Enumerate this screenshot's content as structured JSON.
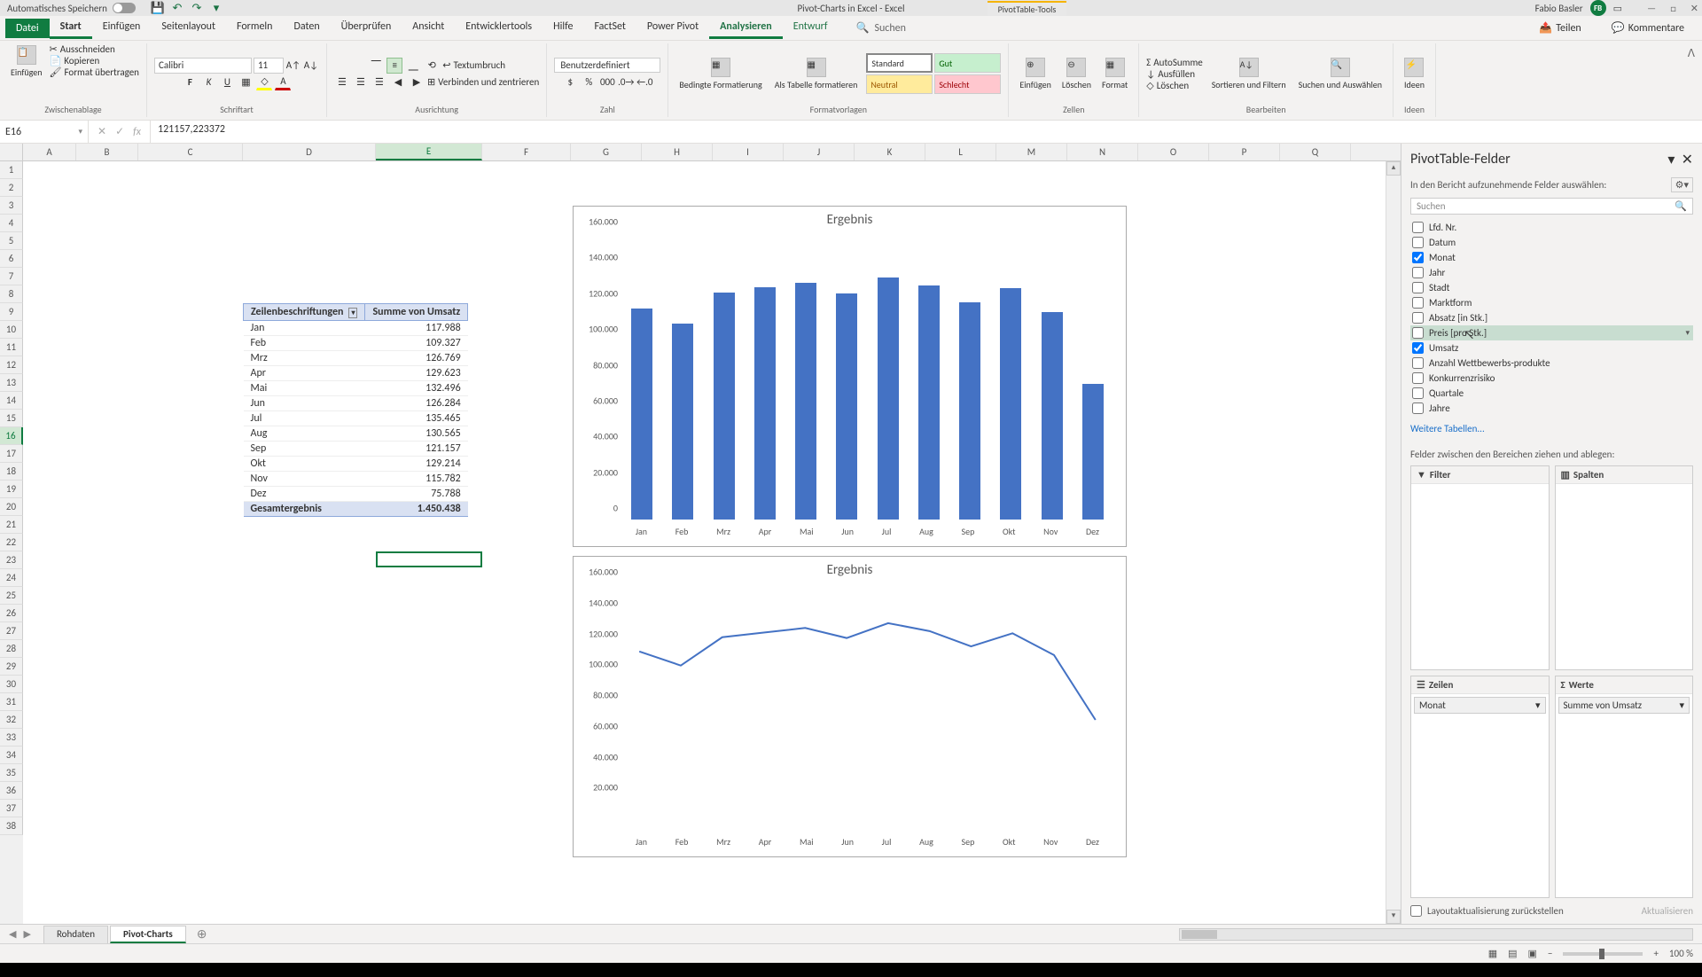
{
  "titlebar": {
    "autosave": "Automatisches Speichern",
    "filename": "Pivot-Charts in Excel - Excel",
    "contextual_tools": "PivotTable-Tools",
    "user_name": "Fabio Basler",
    "user_initials": "FB"
  },
  "tabs": {
    "file": "Datei",
    "list": [
      "Start",
      "Einfügen",
      "Seitenlayout",
      "Formeln",
      "Daten",
      "Überprüfen",
      "Ansicht",
      "Entwicklertools",
      "Hilfe",
      "FactSet",
      "Power Pivot",
      "Analysieren",
      "Entwurf"
    ],
    "active": "Start",
    "contextual_active": "Analysieren",
    "search": "Suchen",
    "share": "Teilen",
    "comments": "Kommentare"
  },
  "ribbon": {
    "clipboard": {
      "paste": "Einfügen",
      "cut": "Ausschneiden",
      "copy": "Kopieren",
      "format_painter": "Format übertragen",
      "label": "Zwischenablage"
    },
    "font": {
      "name": "Calibri",
      "size": "11",
      "label": "Schriftart"
    },
    "align": {
      "wrap": "Textumbruch",
      "merge": "Verbinden und zentrieren",
      "label": "Ausrichtung"
    },
    "number": {
      "format": "Benutzerdefiniert",
      "label": "Zahl"
    },
    "styles": {
      "cond": "Bedingte Formatierung",
      "table": "Als Tabelle formatieren",
      "std": "Standard",
      "gut": "Gut",
      "neu": "Neutral",
      "bad": "Schlecht",
      "label": "Formatvorlagen"
    },
    "cells": {
      "insert": "Einfügen",
      "delete": "Löschen",
      "format": "Format",
      "label": "Zellen"
    },
    "editing": {
      "sum": "AutoSumme",
      "fill": "Ausfüllen",
      "clear": "Löschen",
      "sort": "Sortieren und Filtern",
      "find": "Suchen und Auswählen",
      "label": "Bearbeiten"
    },
    "ideas": {
      "ideas": "Ideen",
      "label": "Ideen"
    }
  },
  "formula_bar": {
    "name_box": "E16",
    "formula": "121157,223372"
  },
  "columns": [
    "A",
    "B",
    "C",
    "D",
    "E",
    "F",
    "G",
    "H",
    "I",
    "J",
    "K",
    "L",
    "M",
    "N",
    "O",
    "P",
    "Q"
  ],
  "selected_col": "E",
  "selected_row": 16,
  "row_count": 38,
  "pivot_table": {
    "row_header": "Zeilenbeschriftungen",
    "val_header": "Summe von Umsatz",
    "rows": [
      {
        "label": "Jan",
        "val": "117.988"
      },
      {
        "label": "Feb",
        "val": "109.327"
      },
      {
        "label": "Mrz",
        "val": "126.769"
      },
      {
        "label": "Apr",
        "val": "129.623"
      },
      {
        "label": "Mai",
        "val": "132.496"
      },
      {
        "label": "Jun",
        "val": "126.284"
      },
      {
        "label": "Jul",
        "val": "135.465"
      },
      {
        "label": "Aug",
        "val": "130.565"
      },
      {
        "label": "Sep",
        "val": "121.157"
      },
      {
        "label": "Okt",
        "val": "129.214"
      },
      {
        "label": "Nov",
        "val": "115.782"
      },
      {
        "label": "Dez",
        "val": "75.788"
      }
    ],
    "total_label": "Gesamtergebnis",
    "total_val": "1.450.438"
  },
  "chart_data": [
    {
      "type": "bar",
      "title": "Ergebnis",
      "categories": [
        "Jan",
        "Feb",
        "Mrz",
        "Apr",
        "Mai",
        "Jun",
        "Jul",
        "Aug",
        "Sep",
        "Okt",
        "Nov",
        "Dez"
      ],
      "values": [
        117988,
        109327,
        126769,
        129623,
        132496,
        126284,
        135465,
        130565,
        121157,
        129214,
        115782,
        75788
      ],
      "ylim": [
        0,
        160000
      ],
      "yticks": [
        0,
        20000,
        40000,
        60000,
        80000,
        100000,
        120000,
        140000,
        160000
      ],
      "ytick_labels": [
        "0",
        "20.000",
        "40.000",
        "60.000",
        "80.000",
        "100.000",
        "120.000",
        "140.000",
        "160.000"
      ]
    },
    {
      "type": "line",
      "title": "Ergebnis",
      "categories": [
        "Jan",
        "Feb",
        "Mrz",
        "Apr",
        "Mai",
        "Jun",
        "Jul",
        "Aug",
        "Sep",
        "Okt",
        "Nov",
        "Dez"
      ],
      "values": [
        117988,
        109327,
        126769,
        129623,
        132496,
        126284,
        135465,
        130565,
        121157,
        129214,
        115782,
        75788
      ],
      "ylim": [
        0,
        160000
      ],
      "yticks": [
        20000,
        40000,
        60000,
        80000,
        100000,
        120000,
        140000,
        160000
      ],
      "ytick_labels": [
        "20.000",
        "40.000",
        "60.000",
        "80.000",
        "100.000",
        "120.000",
        "140.000",
        "160.000"
      ]
    }
  ],
  "pivot_pane": {
    "title": "PivotTable-Felder",
    "subtitle": "In den Bericht aufzunehmende Felder auswählen:",
    "search_placeholder": "Suchen",
    "fields": [
      {
        "name": "Lfd. Nr.",
        "checked": false
      },
      {
        "name": "Datum",
        "checked": false
      },
      {
        "name": "Monat",
        "checked": true
      },
      {
        "name": "Jahr",
        "checked": false
      },
      {
        "name": "Stadt",
        "checked": false
      },
      {
        "name": "Marktform",
        "checked": false
      },
      {
        "name": "Absatz [in Stk.]",
        "checked": false
      },
      {
        "name": "Preis [pro Stk.]",
        "checked": false,
        "hover": true
      },
      {
        "name": "Umsatz",
        "checked": true
      },
      {
        "name": "Anzahl Wettbewerbs-produkte",
        "checked": false
      },
      {
        "name": "Konkurrenzrisiko",
        "checked": false
      },
      {
        "name": "Quartale",
        "checked": false
      },
      {
        "name": "Jahre",
        "checked": false
      }
    ],
    "more_tables": "Weitere Tabellen...",
    "drag_label": "Felder zwischen den Bereichen ziehen und ablegen:",
    "areas": {
      "filter": "Filter",
      "columns": "Spalten",
      "rows": "Zeilen",
      "values": "Werte",
      "rows_item": "Monat",
      "values_item": "Summe von Umsatz"
    },
    "defer_layout": "Layoutaktualisierung zurückstellen",
    "update": "Aktualisieren"
  },
  "sheets": {
    "tabs": [
      "Rohdaten",
      "Pivot-Charts"
    ],
    "active": "Pivot-Charts"
  },
  "statusbar": {
    "zoom": "100 %"
  }
}
